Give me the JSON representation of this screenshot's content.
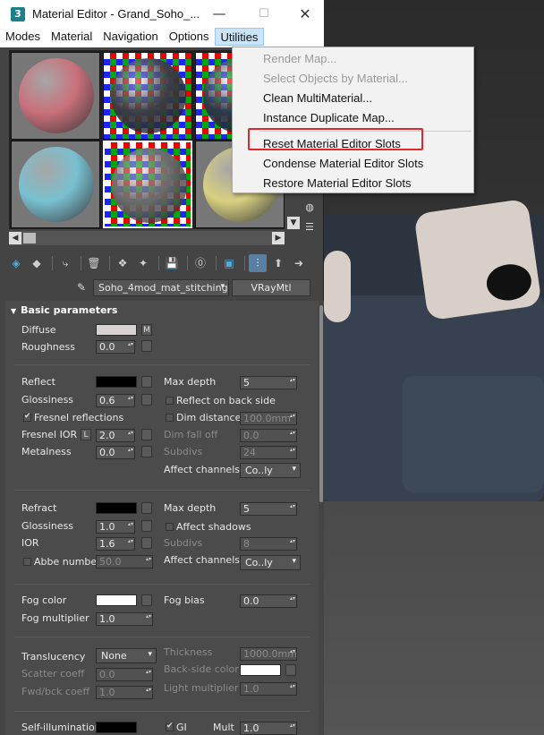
{
  "window": {
    "title": "Material Editor - Grand_Soho_...",
    "app_icon_text": "3",
    "minimize": "—",
    "maximize": "☐",
    "close": "✕"
  },
  "menubar": [
    "Modes",
    "Material",
    "Navigation",
    "Options",
    "Utilities"
  ],
  "active_menu": "Utilities",
  "utilities_menu": {
    "items": [
      {
        "label": "Render Map...",
        "enabled": false
      },
      {
        "label": "Select Objects by Material...",
        "enabled": false
      },
      {
        "label": "Clean MultiMaterial...",
        "enabled": true
      },
      {
        "label": "Instance Duplicate Map...",
        "enabled": true
      },
      {
        "label": "Reset Material Editor Slots",
        "enabled": true,
        "highlighted": true
      },
      {
        "label": "Condense Material Editor Slots",
        "enabled": true
      },
      {
        "label": "Restore Material Editor Slots",
        "enabled": true
      }
    ],
    "highlight_color": "#e0282a"
  },
  "slots": [
    {
      "sphere_color": "#c9707a",
      "background": "gray"
    },
    {
      "sphere_color": "#3b3d42",
      "background": "checker"
    },
    {
      "sphere_color": "#2c3a48",
      "background": "checker"
    },
    {
      "sphere_color": "#78c0d0",
      "background": "gray"
    },
    {
      "sphere_color": "#6a6a6a",
      "background": "checker",
      "selected": true
    },
    {
      "sphere_color": "#d8d080",
      "background": "gray"
    }
  ],
  "material": {
    "name": "Soho_4mod_mat_stitching",
    "type": "VRayMtl"
  },
  "rollout_title": "Basic parameters",
  "basic": {
    "diffuse_label": "Diffuse",
    "diffuse_color": "#d7d2cf",
    "diffuse_map": "M",
    "roughness_label": "Roughness",
    "roughness_value": "0.0"
  },
  "reflection": {
    "reflect_label": "Reflect",
    "reflect_color": "#000000",
    "glossiness_label": "Glossiness",
    "glossiness_value": "0.6",
    "fresnel_label": "Fresnel reflections",
    "fresnel_ior_label": "Fresnel IOR",
    "fresnel_ior_lock": "L",
    "fresnel_ior_value": "2.0",
    "metalness_label": "Metalness",
    "metalness_value": "0.0",
    "max_depth_label": "Max depth",
    "max_depth_value": "5",
    "reflect_back_label": "Reflect on back side",
    "dim_distance_label": "Dim distance",
    "dim_distance_value": "100.0mm",
    "dim_falloff_label": "Dim fall off",
    "dim_falloff_value": "0.0",
    "subdivs_label": "Subdivs",
    "subdivs_value": "24",
    "affect_channels_label": "Affect channels",
    "affect_channels_value": "Co..ly"
  },
  "refraction": {
    "refract_label": "Refract",
    "refract_color": "#000000",
    "glossiness_label": "Glossiness",
    "glossiness_value": "1.0",
    "ior_label": "IOR",
    "ior_value": "1.6",
    "abbe_label": "Abbe number",
    "abbe_value": "50.0",
    "max_depth_label": "Max depth",
    "max_depth_value": "5",
    "affect_shadows_label": "Affect shadows",
    "subdivs_label": "Subdivs",
    "subdivs_value": "8",
    "affect_channels_label": "Affect channels",
    "affect_channels_value": "Co..ly"
  },
  "fog": {
    "fog_color_label": "Fog color",
    "fog_color": "#ffffff",
    "fog_multiplier_label": "Fog multiplier",
    "fog_multiplier_value": "1.0",
    "fog_bias_label": "Fog bias",
    "fog_bias_value": "0.0"
  },
  "translucency": {
    "translucency_label": "Translucency",
    "translucency_value": "None",
    "scatter_label": "Scatter coeff",
    "scatter_value": "0.0",
    "fwd_bck_label": "Fwd/bck coeff",
    "fwd_bck_value": "1.0",
    "thickness_label": "Thickness",
    "thickness_value": "1000.0mm",
    "back_side_color_label": "Back-side color",
    "back_side_color": "#ffffff",
    "light_multiplier_label": "Light multiplier",
    "light_multiplier_value": "1.0"
  },
  "self_illum": {
    "label": "Self-illumination",
    "gi_label": "GI",
    "mult_label": "Mult",
    "mult_value": "1.0"
  }
}
